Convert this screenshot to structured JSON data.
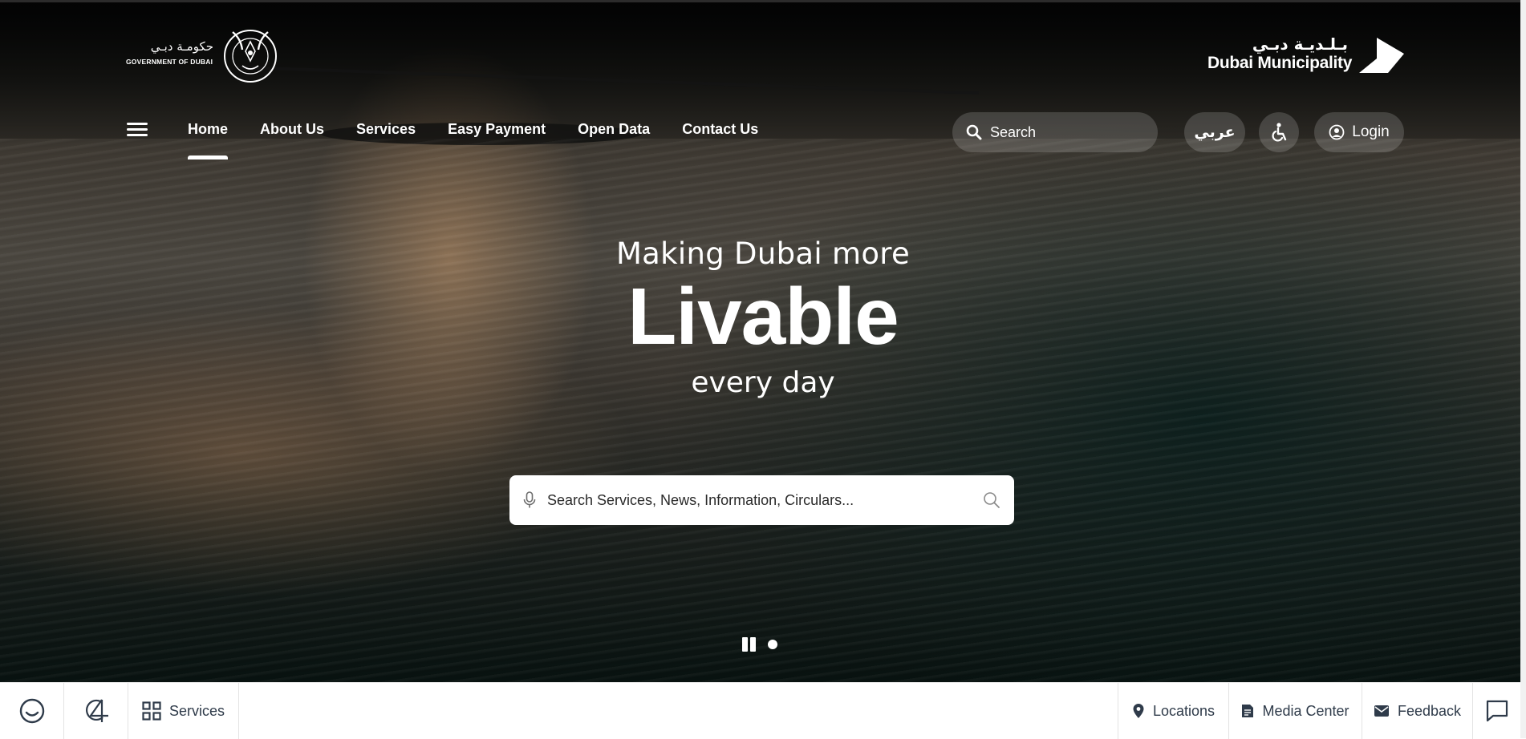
{
  "header": {
    "gov_logo_ar": "حكومـة دبـي",
    "gov_logo_en": "GOVERNMENT OF DUBAI",
    "dm_logo_ar": "بـلـديـة دبـي",
    "dm_logo_en": "Dubai Municipality"
  },
  "nav": {
    "items": [
      {
        "label": "Home",
        "active": true
      },
      {
        "label": "About Us"
      },
      {
        "label": "Services"
      },
      {
        "label": "Easy Payment"
      },
      {
        "label": "Open Data"
      },
      {
        "label": "Contact Us"
      }
    ],
    "search_label": "Search",
    "language_label": "عربي",
    "login_label": "Login"
  },
  "hero": {
    "line1": "Making Dubai more",
    "line2": "Livable",
    "line3": "every day",
    "search_placeholder": "Search Services, News, Information, Circulars..."
  },
  "bottombar": {
    "left": [
      {
        "icon": "smiley-icon"
      },
      {
        "icon": "dubai-2040-icon"
      },
      {
        "icon": "grid-icon",
        "label": "Services"
      }
    ],
    "right": [
      {
        "icon": "location-pin-icon",
        "label": "Locations"
      },
      {
        "icon": "document-icon",
        "label": "Media Center"
      },
      {
        "icon": "envelope-icon",
        "label": "Feedback"
      },
      {
        "icon": "chat-icon"
      }
    ]
  },
  "colors": {
    "bottom_text": "#2f3b4a",
    "pill_bg": "rgba(255,255,255,0.16)"
  }
}
